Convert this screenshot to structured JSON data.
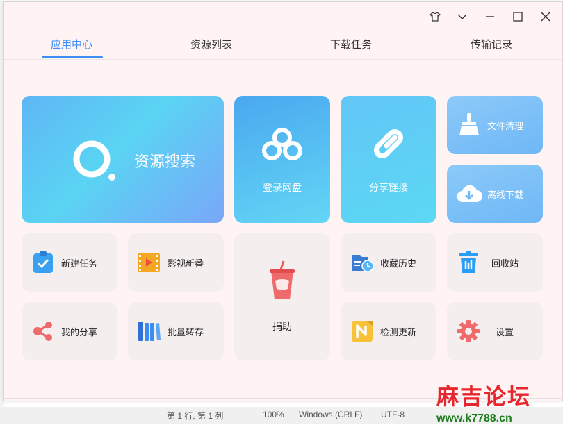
{
  "window": {
    "controls": [
      "skin-icon",
      "dropdown-icon",
      "minimize-icon",
      "maximize-icon",
      "close-icon"
    ]
  },
  "tabs": [
    {
      "label": "应用中心",
      "active": true
    },
    {
      "label": "资源列表",
      "active": false
    },
    {
      "label": "下载任务",
      "active": false
    },
    {
      "label": "传输记录",
      "active": false
    }
  ],
  "tiles": {
    "search": {
      "label": "资源搜索",
      "icon": "search-ring-icon"
    },
    "login_disk": {
      "label": "登录网盘",
      "icon": "cloud-disk-icon"
    },
    "share_link": {
      "label": "分享链接",
      "icon": "link-icon"
    },
    "file_clean": {
      "label": "文件清理",
      "icon": "broom-icon"
    },
    "offline_download": {
      "label": "离线下载",
      "icon": "cloud-download-icon"
    },
    "new_task": {
      "label": "新建任务",
      "icon": "clipboard-check-icon"
    },
    "movies": {
      "label": "影视新番",
      "icon": "film-icon"
    },
    "donate": {
      "label": "捐助",
      "icon": "cup-icon"
    },
    "history": {
      "label": "收藏历史",
      "icon": "history-icon"
    },
    "recycle": {
      "label": "回收站",
      "icon": "trash-icon"
    },
    "my_share": {
      "label": "我的分享",
      "icon": "share-icon"
    },
    "batch_transfer": {
      "label": "批量转存",
      "icon": "books-icon"
    },
    "check_update": {
      "label": "检测更新",
      "icon": "update-icon"
    },
    "settings": {
      "label": "设置",
      "icon": "gear-icon"
    }
  },
  "background_status": {
    "position": "第 1 行, 第 1 列",
    "zoom": "100%",
    "line_ending": "Windows (CRLF)",
    "encoding": "UTF-8"
  },
  "watermark": {
    "title": "麻吉论坛",
    "url": "www.k7788.cn"
  },
  "colors": {
    "accent": "#3e8ef7",
    "window_bg": "#fff3f4",
    "tile_grey": "#f4eeef"
  }
}
